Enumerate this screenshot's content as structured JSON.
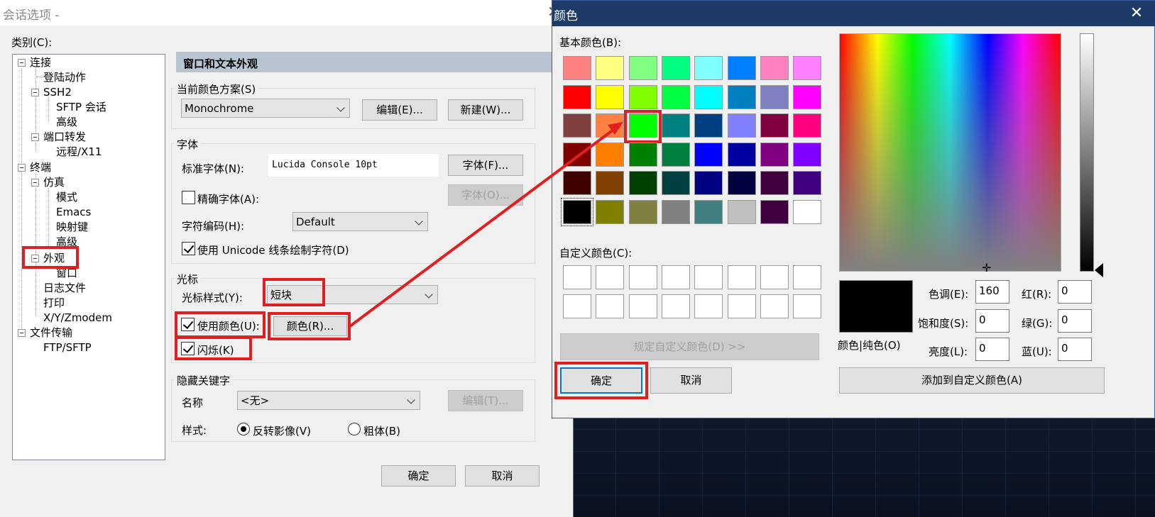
{
  "session_dialog": {
    "title": "会话选项 -",
    "category_label": "类别(C):",
    "tree": [
      "连接",
      "登陆动作",
      "SSH2",
      "SFTP 会话",
      "高级",
      "端口转发",
      "远程/X11",
      "终端",
      "仿真",
      "模式",
      "Emacs",
      "映射键",
      "高级",
      "外观",
      "窗口",
      "日志文件",
      "打印",
      "X/Y/Zmodem",
      "文件传输",
      "FTP/SFTP"
    ],
    "section_header": "窗口和文本外观",
    "color_scheme": {
      "group": "当前颜色方案(S)",
      "value": "Monochrome",
      "edit_button": "编辑(E)...",
      "new_button": "新建(W)..."
    },
    "font": {
      "group": "字体",
      "normal_font_label": "标准字体(N):",
      "normal_font_value": "Lucida Console 10pt",
      "font_button": "字体(F)...",
      "precise_font_label": "精确字体(A):",
      "precise_font_checked": false,
      "font_button_disabled": "字体(O)...",
      "encoding_label": "字符编码(H):",
      "encoding_value": "Default",
      "unicode_label": "使用 Unicode 线条绘制字符(D)",
      "unicode_checked": true
    },
    "cursor": {
      "group": "光标",
      "style_label": "光标样式(Y):",
      "style_value": "短块",
      "use_color_label": "使用颜色(U):",
      "use_color_checked": true,
      "color_button": "颜色(R)...",
      "blink_label": "闪烁(K)",
      "blink_checked": true
    },
    "hidden_keyword": {
      "group": "隐藏关键字",
      "name_label": "名称",
      "name_value": "<无>",
      "edit_button": "编辑(T)...",
      "style_label": "样式:",
      "reverse_label": "反转影像(V)",
      "bold_label": "粗体(B)",
      "selected": "reverse"
    },
    "ok_button": "确定",
    "cancel_button": "取消"
  },
  "color_dialog": {
    "title": "颜色",
    "basic_label": "基本颜色(B):",
    "basic_colors": [
      "#ff8080",
      "#ffff80",
      "#80ff80",
      "#00ff80",
      "#80ffff",
      "#0080ff",
      "#ff80c0",
      "#ff80ff",
      "#ff0000",
      "#ffff00",
      "#80ff00",
      "#00ff40",
      "#00ffff",
      "#0080c0",
      "#8080c0",
      "#ff00ff",
      "#804040",
      "#ff8040",
      "#00ff00",
      "#008080",
      "#004080",
      "#8080ff",
      "#800040",
      "#ff0080",
      "#800000",
      "#ff8000",
      "#008000",
      "#008040",
      "#0000ff",
      "#0000a0",
      "#800080",
      "#8000ff",
      "#400000",
      "#804000",
      "#004000",
      "#004040",
      "#000080",
      "#000040",
      "#400040",
      "#400080",
      "#000000",
      "#808000",
      "#808040",
      "#808080",
      "#408080",
      "#c0c0c0",
      "#400040",
      "#ffffff"
    ],
    "custom_label": "自定义颜色(C):",
    "define_custom_button": "规定自定义颜色(D) >>",
    "ok_button": "确定",
    "cancel_button": "取消",
    "solid_label": "颜色|纯色(O)",
    "hue_label": "色调(E):",
    "hue_value": "160",
    "sat_label": "饱和度(S):",
    "sat_value": "0",
    "lum_label": "亮度(L):",
    "lum_value": "0",
    "red_label": "红(R):",
    "red_value": "0",
    "green_label": "绿(G):",
    "green_value": "0",
    "blue_label": "蓝(U):",
    "blue_value": "0",
    "add_custom_button": "添加到自定义颜色(A)",
    "highlight_color": "#e02020"
  }
}
